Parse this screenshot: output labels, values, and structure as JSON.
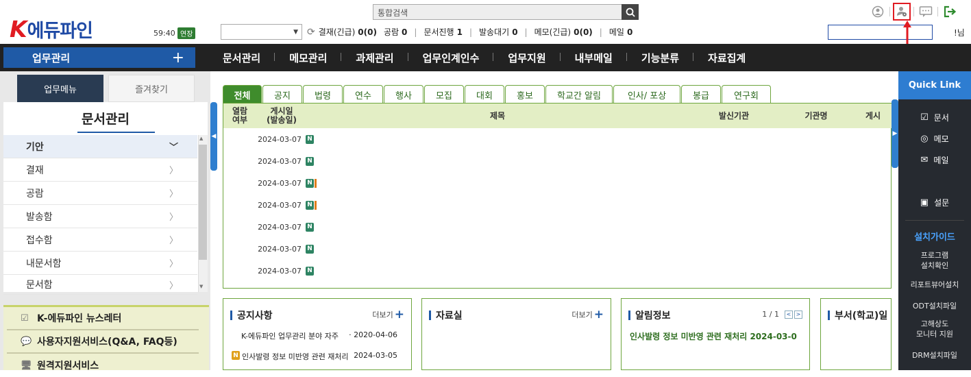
{
  "header": {
    "logo_text": "에듀파인",
    "logo_k": "K",
    "session_timer": "59:40",
    "extend_label": "연장",
    "search_placeholder": "통합검색",
    "dept_select_value": "",
    "counters": [
      {
        "label": "결재(긴급)",
        "value": "0(0)"
      },
      {
        "label": "공람",
        "value": "0"
      },
      {
        "label": "문서진행",
        "value": "1"
      },
      {
        "label": "발송대기",
        "value": "0"
      },
      {
        "label": "메모(긴급)",
        "value": "0(0)"
      },
      {
        "label": "메일",
        "value": "0"
      }
    ],
    "right_input_value": "",
    "right_text": "!님"
  },
  "nav": {
    "work_menu_label": "업무관리",
    "items": [
      "문서관리",
      "메모관리",
      "과제관리",
      "업무인계인수",
      "업무지원",
      "내부메일",
      "기능분류",
      "자료집계"
    ]
  },
  "left": {
    "tab_work": "업무메뉴",
    "tab_fav": "즐겨찾기",
    "title": "문서관리",
    "menu": [
      "기안",
      "결재",
      "공람",
      "발송함",
      "접수함",
      "내문서함",
      "문서함"
    ],
    "links": [
      "K-에듀파인 뉴스레터",
      "사용자지원서비스(Q&A, FAQ등)",
      "원격지원서비스"
    ]
  },
  "board": {
    "tabs": [
      "전체",
      "공지",
      "법령",
      "연수",
      "행사",
      "모집",
      "대회",
      "홍보",
      "학교간 알림",
      "인사/ 포상",
      "봉급",
      "연구회"
    ],
    "headers": {
      "read": "열람\n여부",
      "posted": "게시일\n(발송일)",
      "subject": "제목",
      "sender": "발신기관",
      "agency": "기관명",
      "post": "게시"
    },
    "rows": [
      {
        "date": "2024-03-07",
        "badge": "N",
        "extra": false
      },
      {
        "date": "2024-03-07",
        "badge": "N",
        "extra": false
      },
      {
        "date": "2024-03-07",
        "badge": "N",
        "extra": true
      },
      {
        "date": "2024-03-07",
        "badge": "N",
        "extra": true
      },
      {
        "date": "2024-03-07",
        "badge": "N",
        "extra": false
      },
      {
        "date": "2024-03-07",
        "badge": "N",
        "extra": false
      },
      {
        "date": "2024-03-07",
        "badge": "N",
        "extra": false
      }
    ]
  },
  "boxes": {
    "notice": {
      "title": "공지사항",
      "more": "더보기",
      "items": [
        {
          "badge": "",
          "text": "K-에듀파인 업무관리 분야 자주",
          "date": "· 2020-04-06"
        },
        {
          "badge": "N",
          "text": "인사발령 정보 미반영 관련 재처리",
          "date": "2024-03-05"
        }
      ]
    },
    "library": {
      "title": "자료실",
      "more": "더보기"
    },
    "alerts": {
      "title": "알림정보",
      "page": "1 / 1",
      "item": "인사발령 정보 미반영 관련 재처리 2024-03-0"
    },
    "dept": {
      "title": "부서(학교)일"
    }
  },
  "quick_link": {
    "title": "Quick Link",
    "items": [
      {
        "icon": "document-icon",
        "label": "문서"
      },
      {
        "icon": "memo-icon",
        "label": "메모"
      },
      {
        "icon": "mail-icon",
        "label": "메일"
      },
      {
        "icon": "survey-icon",
        "label": "설문"
      }
    ],
    "guide_title": "설치가이드",
    "guide_items": [
      "프로그램\n설치확인",
      "리포트뷰어설치",
      "ODT설치파일",
      "고해상도\n모니터 지원",
      "DRM설치파일"
    ]
  },
  "colors": {
    "brand_blue": "#1f5aa6",
    "green": "#3f8c2c",
    "highlight_red": "#e01b22",
    "quick_bg": "#262a30"
  }
}
